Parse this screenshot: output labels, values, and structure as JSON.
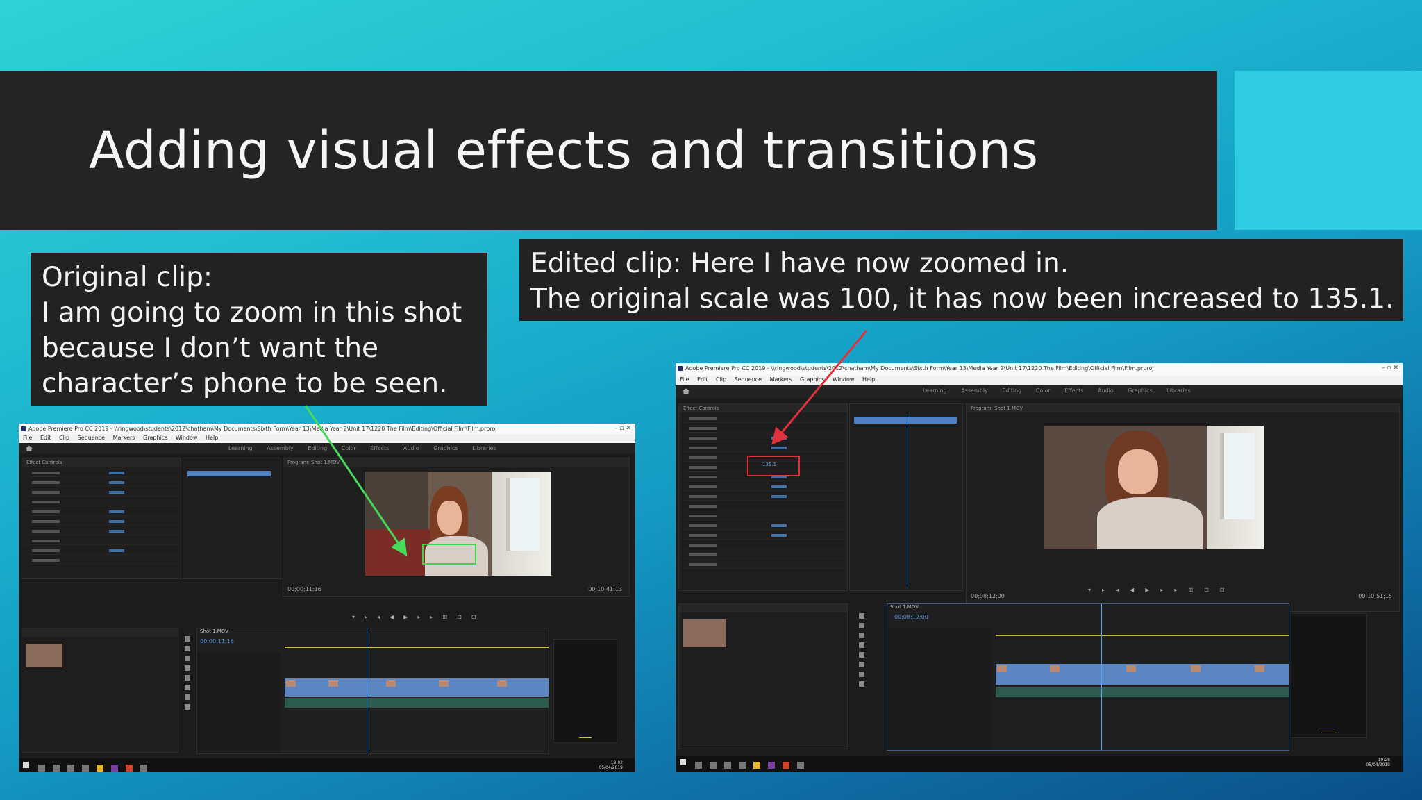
{
  "slide": {
    "title": "Adding visual effects and transitions",
    "left_caption": [
      "Original clip:",
      "I am going to zoom in this shot",
      "because I don’t want the",
      "character’s phone to be seen."
    ],
    "right_caption": [
      "Edited clip: Here I have now zoomed in.",
      "The original scale was 100, it has now been increased to 135.1."
    ]
  },
  "colors": {
    "title_bar": "#242424",
    "accent_square": "#2fcbe3",
    "green_arrow": "#46d95a",
    "red_arrow": "#e0323c",
    "premiere_bg": "#1e1e1e"
  },
  "left_screenshot": {
    "app_title": "Adobe Premiere Pro CC 2019 - \\\\ringwood\\students\\2012\\chatham\\My Documents\\Sixth Form\\Year 13\\Media Year 2\\Unit 17\\1220 The Film\\Editing\\Official Film\\Film.prproj",
    "menu": [
      "File",
      "Edit",
      "Clip",
      "Sequence",
      "Markers",
      "Graphics",
      "Window",
      "Help"
    ],
    "workspaces": [
      "Learning",
      "Assembly",
      "Editing",
      "Color",
      "Effects",
      "Audio",
      "Graphics",
      "Libraries"
    ],
    "effect_controls_tab": "Effect Controls",
    "program_tab": "Program: Shot 1.MOV",
    "timecode_program": "00;00;11;16",
    "timecode_end": "00;10;41;13",
    "timeline_tab": "Shot 1.MOV",
    "timeline_timecode": "00;00;11;16",
    "clock_time": "19:02",
    "clock_date": "05/04/2019"
  },
  "right_screenshot": {
    "app_title": "Adobe Premiere Pro CC 2019 - \\\\ringwood\\students\\2012\\chatham\\My Documents\\Sixth Form\\Year 13\\Media Year 2\\Unit 17\\1220 The Film\\Editing\\Official Film\\Film.prproj",
    "menu": [
      "File",
      "Edit",
      "Clip",
      "Sequence",
      "Markers",
      "Graphics",
      "Window",
      "Help"
    ],
    "workspaces": [
      "Learning",
      "Assembly",
      "Editing",
      "Color",
      "Effects",
      "Audio",
      "Graphics",
      "Libraries"
    ],
    "effect_controls_tab": "Effect Controls",
    "program_tab": "Program: Shot 1.MOV",
    "timecode_program": "00;08;12;00",
    "timecode_end": "00;10;51;15",
    "timeline_tab": "Shot 1.MOV",
    "timeline_timecode": "00;08;12;00",
    "scale_value": "135.1",
    "clock_time": "19:28",
    "clock_date": "05/04/2019"
  }
}
